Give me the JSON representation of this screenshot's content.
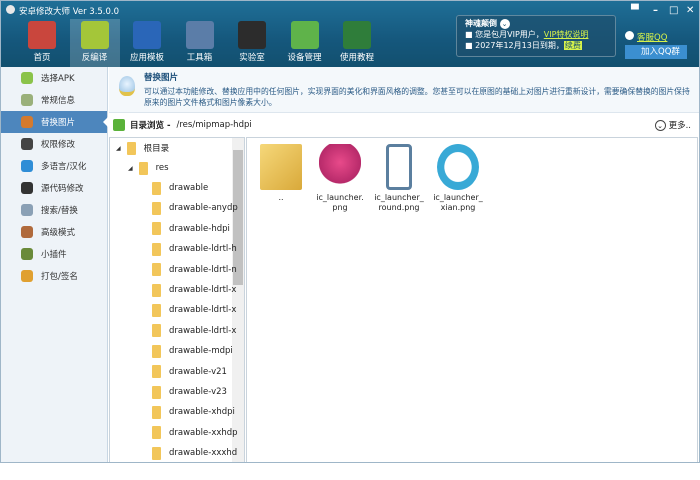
{
  "window": {
    "title": "安卓修改大师 Ver 3.5.0.0"
  },
  "toolbar": [
    {
      "label": "首页",
      "color": "#c9463d"
    },
    {
      "label": "反编译",
      "color": "#a4c639"
    },
    {
      "label": "应用模板",
      "color": "#2a66b8"
    },
    {
      "label": "工具箱",
      "color": "#5b7da8"
    },
    {
      "label": "实验室",
      "color": "#2c2c2c"
    },
    {
      "label": "设备管理",
      "color": "#5fb34a"
    },
    {
      "label": "使用教程",
      "color": "#2f7d3a"
    }
  ],
  "vip": {
    "title": "神魂颠倒",
    "line1": "您是包月VIP用户，",
    "link1": "VIP特权说明",
    "line2": "2027年12月13日到期，",
    "renew": "续费"
  },
  "links": {
    "service_qq": "客服QQ",
    "join_group": "加入QQ群"
  },
  "sidebar": [
    {
      "label": "选择APK",
      "color": "#8bc34a"
    },
    {
      "label": "常规信息",
      "color": "#9ab07a"
    },
    {
      "label": "替换图片",
      "color": "#d47a2e",
      "selected": true
    },
    {
      "label": "权限修改",
      "color": "#444"
    },
    {
      "label": "多语言/汉化",
      "color": "#2f8dd6"
    },
    {
      "label": "源代码修改",
      "color": "#333"
    },
    {
      "label": "搜索/替换",
      "color": "#8aa0b5"
    },
    {
      "label": "高级模式",
      "color": "#b06a3c"
    },
    {
      "label": "小插件",
      "color": "#6a8a3a"
    },
    {
      "label": "打包/签名",
      "color": "#e0a030"
    }
  ],
  "info": {
    "title": "替换图片",
    "desc": "可以通过本功能修改、替换应用中的任何图片，实现界面的美化和界面风格的调整。您甚至可以在原图的基础上对图片进行重新设计，需要确保替换的图片保持原来的图片文件格式和图片像素大小。"
  },
  "dir": {
    "label": "目录浏览 -",
    "path": "/res/mipmap-hdpi",
    "more": "更多.."
  },
  "tree": {
    "root": "根目录",
    "res": "res",
    "folders": [
      "drawable",
      "drawable-anydp",
      "drawable-hdpi",
      "drawable-ldrtl-h",
      "drawable-ldrtl-n",
      "drawable-ldrtl-x",
      "drawable-ldrtl-x",
      "drawable-ldrtl-x",
      "drawable-mdpi",
      "drawable-v21",
      "drawable-v23",
      "drawable-xhdpi",
      "drawable-xxhdp",
      "drawable-xxxhd"
    ]
  },
  "files": [
    {
      "name": "..",
      "icon": "folder-up-icon"
    },
    {
      "name": "ic_launcher.\npng",
      "icon": "app-icon"
    },
    {
      "name": "ic_launcher_\nround.png",
      "icon": "phone-icon"
    },
    {
      "name": "ic_launcher_\nxian.png",
      "icon": "imei-icon"
    }
  ]
}
